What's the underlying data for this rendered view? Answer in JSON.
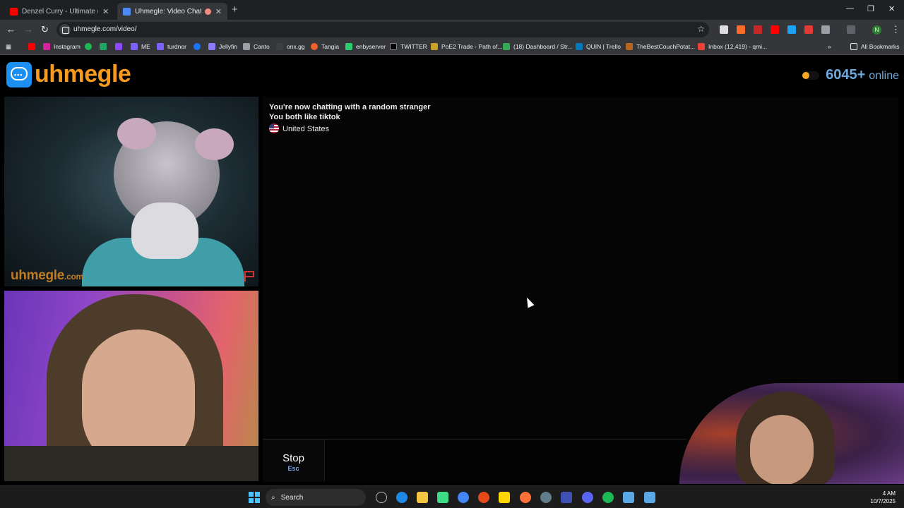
{
  "browser": {
    "tabs": [
      {
        "title": "Denzel Curry - Ultimate (BADBA",
        "favicon_color": "#ff0000"
      },
      {
        "title": "Uhmegle: Video Chat | Omeg",
        "favicon_color": "#4c8bf5"
      }
    ],
    "url": "uhmegle.com/video/",
    "bookmarks": [
      {
        "label": "Instagram",
        "color": "#d6249f"
      },
      {
        "label": "ME",
        "color": "#7b61ff"
      },
      {
        "label": "turdnor",
        "color": "#7b61ff"
      },
      {
        "label": "Jellyfin",
        "color": "#8c7bff"
      },
      {
        "label": "Canto",
        "color": "#9aa0a6"
      },
      {
        "label": "onx.gg",
        "color": "#3c4043"
      },
      {
        "label": "Tangia",
        "color": "#f0602a"
      },
      {
        "label": "enbyserver",
        "color": "#2ecc71"
      },
      {
        "label": "TWITTER",
        "color": "#000000"
      },
      {
        "label": "PoE2 Trade - Path of...",
        "color": "#c9a227"
      },
      {
        "label": "(18) Dashboard / Str...",
        "color": "#35a853"
      },
      {
        "label": "QUIN | Trello",
        "color": "#0079bf"
      },
      {
        "label": "TheBestCouchPotat...",
        "color": "#b5651d"
      },
      {
        "label": "Inbox (12,419) - qmi...",
        "color": "#ea4335"
      }
    ],
    "all_bookmarks": "All Bookmarks",
    "profile_initial": "N"
  },
  "site": {
    "logo_text": "uhmegle",
    "online_count": "6045+",
    "online_label": "online",
    "watermark": "uhmegle",
    "watermark_suffix": ".com",
    "accent": "#f79a1d"
  },
  "chat": {
    "line1": "You're now chatting with a random stranger",
    "line2": "You both like tiktok",
    "country": "United States"
  },
  "controls": {
    "stop_label": "Stop",
    "stop_key": "Esc"
  },
  "taskbar": {
    "search_label": "Search",
    "time": "4 AM",
    "date": "10/7/2025"
  }
}
